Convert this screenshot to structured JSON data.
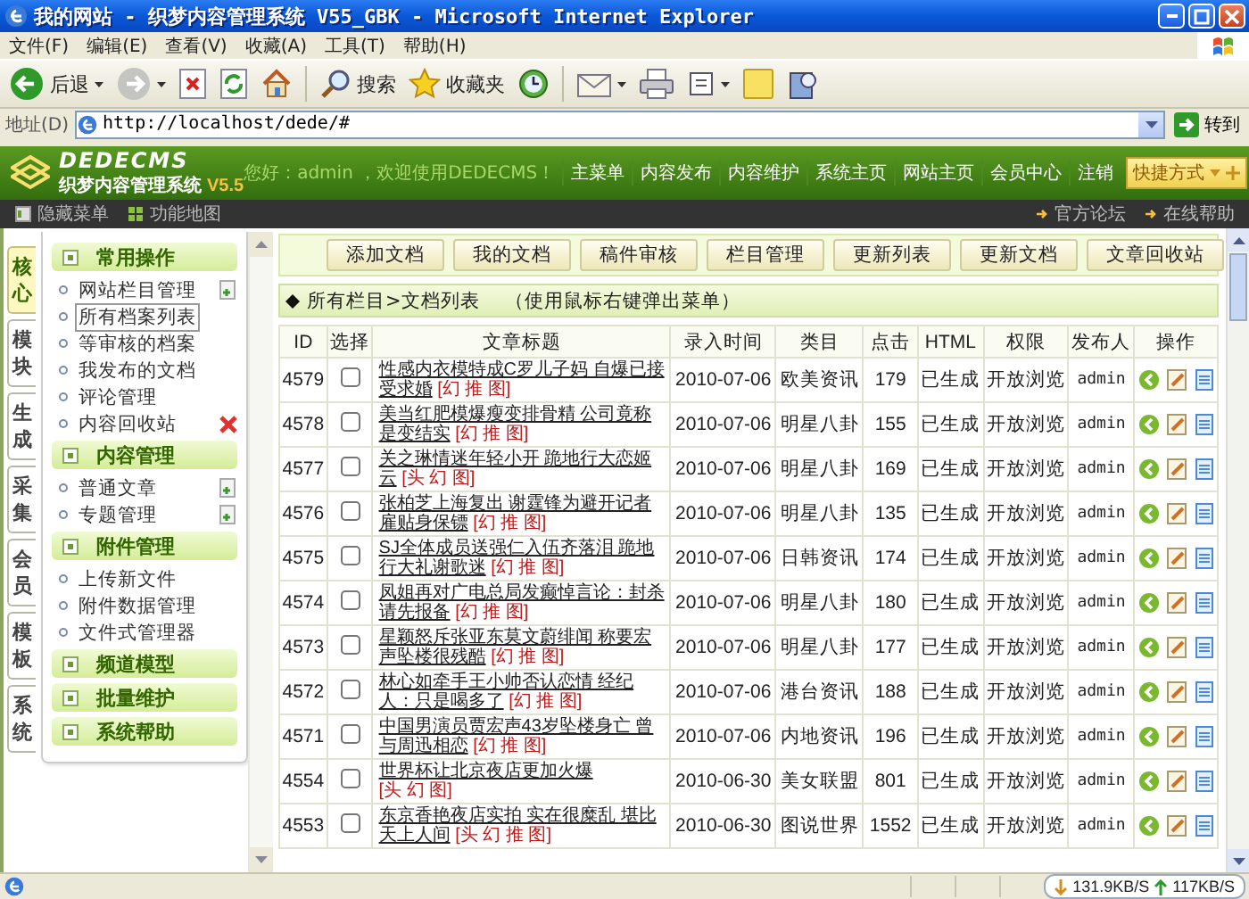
{
  "window": {
    "title": "我的网站 - 织梦内容管理系统 V55_GBK - Microsoft Internet Explorer"
  },
  "menu_bar": [
    "文件(F)",
    "编辑(E)",
    "查看(V)",
    "收藏(A)",
    "工具(T)",
    "帮助(H)"
  ],
  "toolbar": {
    "back": "后退",
    "search": "搜索",
    "favorites": "收藏夹"
  },
  "address_bar": {
    "label": "地址(D)",
    "value": "http://localhost/dede/#",
    "go": "转到"
  },
  "app_header": {
    "logo": "DEDECMS",
    "subtitle": "织梦内容管理系统",
    "version": "V5.5",
    "greeting": "您好：admin ，欢迎使用DEDECMS！",
    "nav": [
      "主菜单",
      "内容发布",
      "内容维护",
      "系统主页",
      "网站主页",
      "会员中心",
      "注销"
    ],
    "quick": "快捷方式"
  },
  "sub_bar": {
    "left": [
      "隐藏菜单",
      "功能地图"
    ],
    "right": [
      "官方论坛",
      "在线帮助"
    ]
  },
  "side_tabs": [
    {
      "label": "核心",
      "selected": true
    },
    {
      "label": "模块",
      "selected": false
    },
    {
      "label": "生成",
      "selected": false
    },
    {
      "label": "采集",
      "selected": false
    },
    {
      "label": "会员",
      "selected": false
    },
    {
      "label": "模板",
      "selected": false
    },
    {
      "label": "系统",
      "selected": false
    }
  ],
  "sidebar": [
    {
      "title": "常用操作",
      "items": [
        {
          "label": "网站栏目管理",
          "selected": false,
          "kind": "add"
        },
        {
          "label": "所有档案列表",
          "selected": true,
          "kind": "plain"
        },
        {
          "label": "等审核的档案",
          "selected": false,
          "kind": "plain"
        },
        {
          "label": "我发布的文档",
          "selected": false,
          "kind": "plain"
        },
        {
          "label": "评论管理",
          "selected": false,
          "kind": "plain"
        },
        {
          "label": "内容回收站",
          "selected": false,
          "kind": "delete"
        }
      ]
    },
    {
      "title": "内容管理",
      "items": [
        {
          "label": "普通文章",
          "selected": false,
          "kind": "add"
        },
        {
          "label": "专题管理",
          "selected": false,
          "kind": "add"
        }
      ]
    },
    {
      "title": "附件管理",
      "items": [
        {
          "label": "上传新文件",
          "selected": false,
          "kind": "plain"
        },
        {
          "label": "附件数据管理",
          "selected": false,
          "kind": "plain"
        },
        {
          "label": "文件式管理器",
          "selected": false,
          "kind": "plain"
        }
      ]
    },
    {
      "title": "频道模型"
    },
    {
      "title": "批量维护"
    },
    {
      "title": "系统帮助"
    }
  ],
  "action_buttons": [
    "添加文档",
    "我的文档",
    "稿件审核",
    "栏目管理",
    "更新列表",
    "更新文档",
    "文章回收站"
  ],
  "list_heading": {
    "path": "所有栏目>文档列表",
    "hint": "（使用鼠标右键弹出菜单）"
  },
  "table": {
    "columns": [
      "ID",
      "选择",
      "文章标题",
      "录入时间",
      "类目",
      "点击",
      "HTML",
      "权限",
      "发布人",
      "操作"
    ],
    "rows": [
      {
        "id": "4579",
        "checked": false,
        "title": "性感内衣模特成C罗儿子妈 自爆已接受求婚",
        "tags": "[幻 推 图]",
        "date": "2010-07-06",
        "category": "欧美资讯",
        "clicks": "179",
        "html": "已生成",
        "access": "开放浏览",
        "author": "admin"
      },
      {
        "id": "4578",
        "checked": false,
        "title": "美当红肥模爆瘦变排骨精 公司竟称是变结实",
        "tags": "[幻 推 图]",
        "date": "2010-07-06",
        "category": "明星八卦",
        "clicks": "155",
        "html": "已生成",
        "access": "开放浏览",
        "author": "admin"
      },
      {
        "id": "4577",
        "checked": false,
        "title": "关之琳情迷年轻小开 跪地行大恋姬云",
        "tags": "[头 幻 图]",
        "date": "2010-07-06",
        "category": "明星八卦",
        "clicks": "169",
        "html": "已生成",
        "access": "开放浏览",
        "author": "admin"
      },
      {
        "id": "4576",
        "checked": false,
        "title": "张柏芝上海复出 谢霆锋为避开记者雇贴身保镖",
        "tags": "[幻 推 图]",
        "date": "2010-07-06",
        "category": "明星八卦",
        "clicks": "135",
        "html": "已生成",
        "access": "开放浏览",
        "author": "admin"
      },
      {
        "id": "4575",
        "checked": false,
        "title": "SJ全体成员送强仁入伍齐落泪 跪地行大礼谢歌迷",
        "tags": "[幻 推 图]",
        "date": "2010-07-06",
        "category": "日韩资讯",
        "clicks": "174",
        "html": "已生成",
        "access": "开放浏览",
        "author": "admin"
      },
      {
        "id": "4574",
        "checked": false,
        "title": "凤姐再对广电总局发癫悼言论：封杀请先报备",
        "tags": "[幻 推 图]",
        "date": "2010-07-06",
        "category": "明星八卦",
        "clicks": "180",
        "html": "已生成",
        "access": "开放浏览",
        "author": "admin"
      },
      {
        "id": "4573",
        "checked": false,
        "title": "星颖怒斥张亚东莫文蔚绯闻 称要宏声坠楼很残酷",
        "tags": "[幻 推 图]",
        "date": "2010-07-06",
        "category": "明星八卦",
        "clicks": "177",
        "html": "已生成",
        "access": "开放浏览",
        "author": "admin"
      },
      {
        "id": "4572",
        "checked": false,
        "title": "林心如牵手王小帅否认恋情 经纪人：只是喝多了",
        "tags": "[幻 推 图]",
        "date": "2010-07-06",
        "category": "港台资讯",
        "clicks": "188",
        "html": "已生成",
        "access": "开放浏览",
        "author": "admin"
      },
      {
        "id": "4571",
        "checked": false,
        "title": "中国男演员贾宏声43岁坠楼身亡 曾与周迅相恋",
        "tags": "[幻 推 图]",
        "date": "2010-07-06",
        "category": "内地资讯",
        "clicks": "196",
        "html": "已生成",
        "access": "开放浏览",
        "author": "admin"
      },
      {
        "id": "4554",
        "checked": false,
        "title": "世界杯让北京夜店更加火爆",
        "tags": "[头 幻 图]",
        "date": "2010-06-30",
        "category": "美女联盟",
        "clicks": "801",
        "html": "已生成",
        "access": "开放浏览",
        "author": "admin"
      },
      {
        "id": "4553",
        "checked": false,
        "title": "东京香艳夜店实拍 实在很糜乱 堪比天上人间",
        "tags": "[头 幻 推 图]",
        "date": "2010-06-30",
        "category": "图说世界",
        "clicks": "1552",
        "html": "已生成",
        "access": "开放浏览",
        "author": "admin"
      }
    ]
  },
  "status_bar": {
    "download": "131.9KB/S",
    "upload": "117KB/S"
  }
}
